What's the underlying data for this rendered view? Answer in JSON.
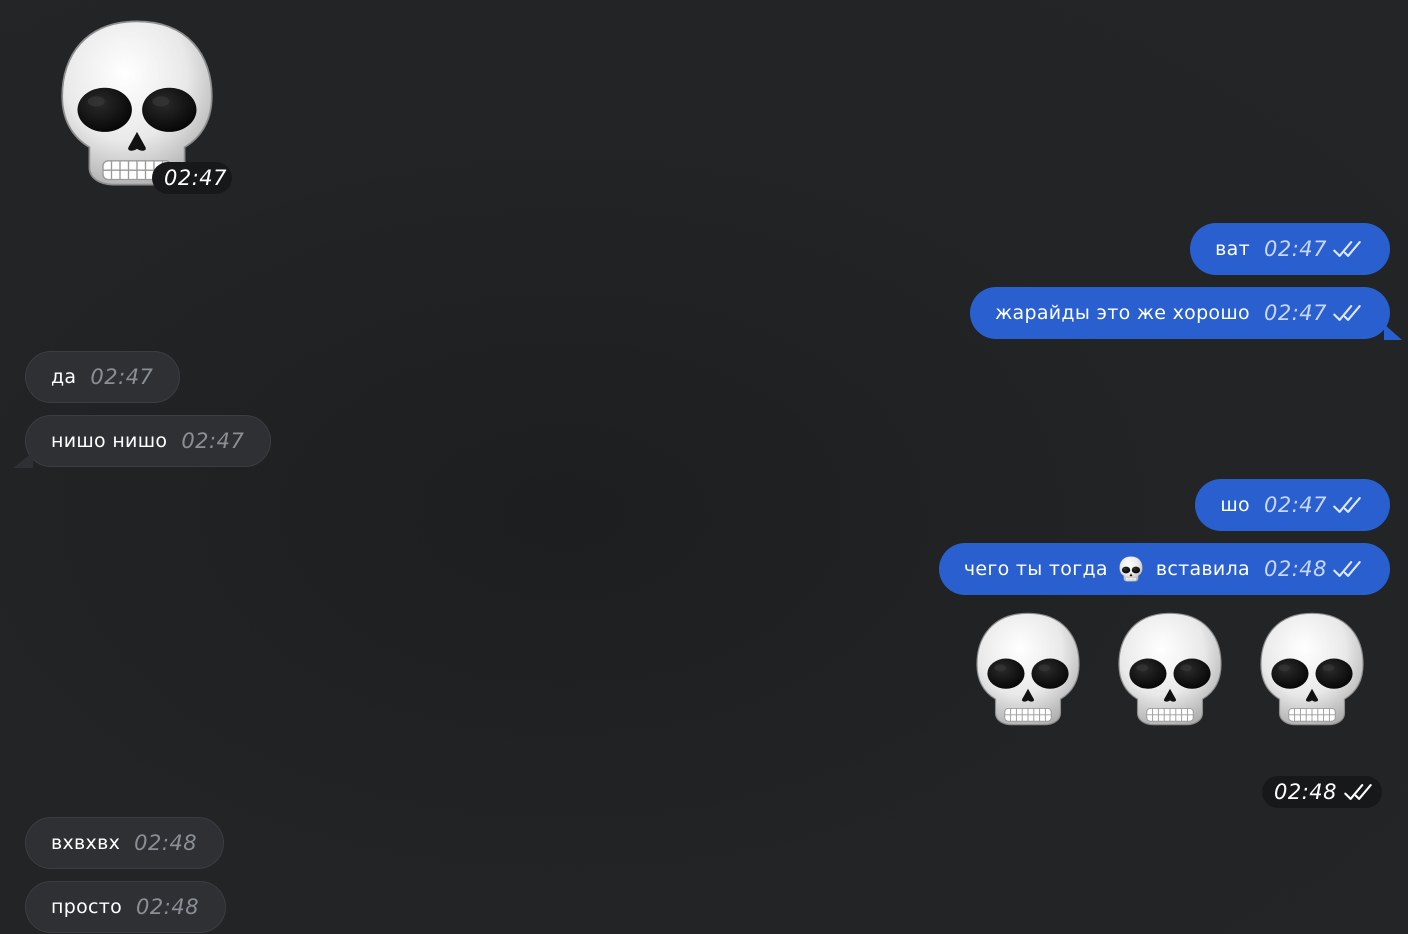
{
  "sticker_message": {
    "emoji": "skull-icon",
    "time": "02:47"
  },
  "outgoing": [
    {
      "text": "ват",
      "time": "02:47",
      "status": "double-check-icon"
    },
    {
      "text": "жарайды это же хорошо",
      "time": "02:47",
      "status": "double-check-icon"
    },
    {
      "text": "шо",
      "time": "02:47",
      "status": "double-check-icon"
    },
    {
      "text_before": "чего ты тогда",
      "inline_emoji": "skull-icon",
      "text_after": "вставила",
      "time": "02:48",
      "status": "double-check-icon"
    }
  ],
  "incoming": [
    {
      "text": "да",
      "time": "02:47"
    },
    {
      "text": "нишо нишо",
      "time": "02:47"
    },
    {
      "text": "вхвхвх",
      "time": "02:48"
    },
    {
      "text": "просто",
      "time": "02:48"
    }
  ],
  "emoji_message": {
    "emojis": [
      "skull-icon",
      "skull-icon",
      "skull-icon"
    ],
    "time": "02:48",
    "status": "double-check-icon"
  },
  "colors": {
    "background": "#212325",
    "outgoing_bubble": "#2a5fd0",
    "incoming_bubble": "#2e3033"
  }
}
